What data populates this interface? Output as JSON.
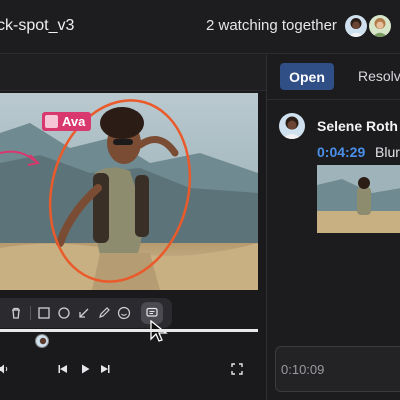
{
  "header": {
    "title": "ck-spot_v3",
    "watching_text": "2 watching together"
  },
  "video": {
    "annotation_label": "Ava"
  },
  "comments_panel": {
    "tabs": [
      {
        "label": "Open",
        "active": true
      },
      {
        "label": "Resolve",
        "active": false
      }
    ],
    "comment": {
      "author": "Selene Roth",
      "timestamp": "0:04:29",
      "text": "Blur"
    }
  },
  "comment_input": {
    "timestamp": "0:10:09"
  },
  "toolbar": {
    "tools": [
      "trash-icon",
      "rectangle-icon",
      "circle-icon",
      "arrow-icon",
      "pen-icon",
      "emoji-icon",
      "comment-icon"
    ]
  },
  "colors": {
    "accent_blue": "#2f4f86",
    "timestamp_blue": "#4a90e8",
    "annotation_pink": "#d9386f",
    "annotation_orange": "#ea5a2a"
  }
}
